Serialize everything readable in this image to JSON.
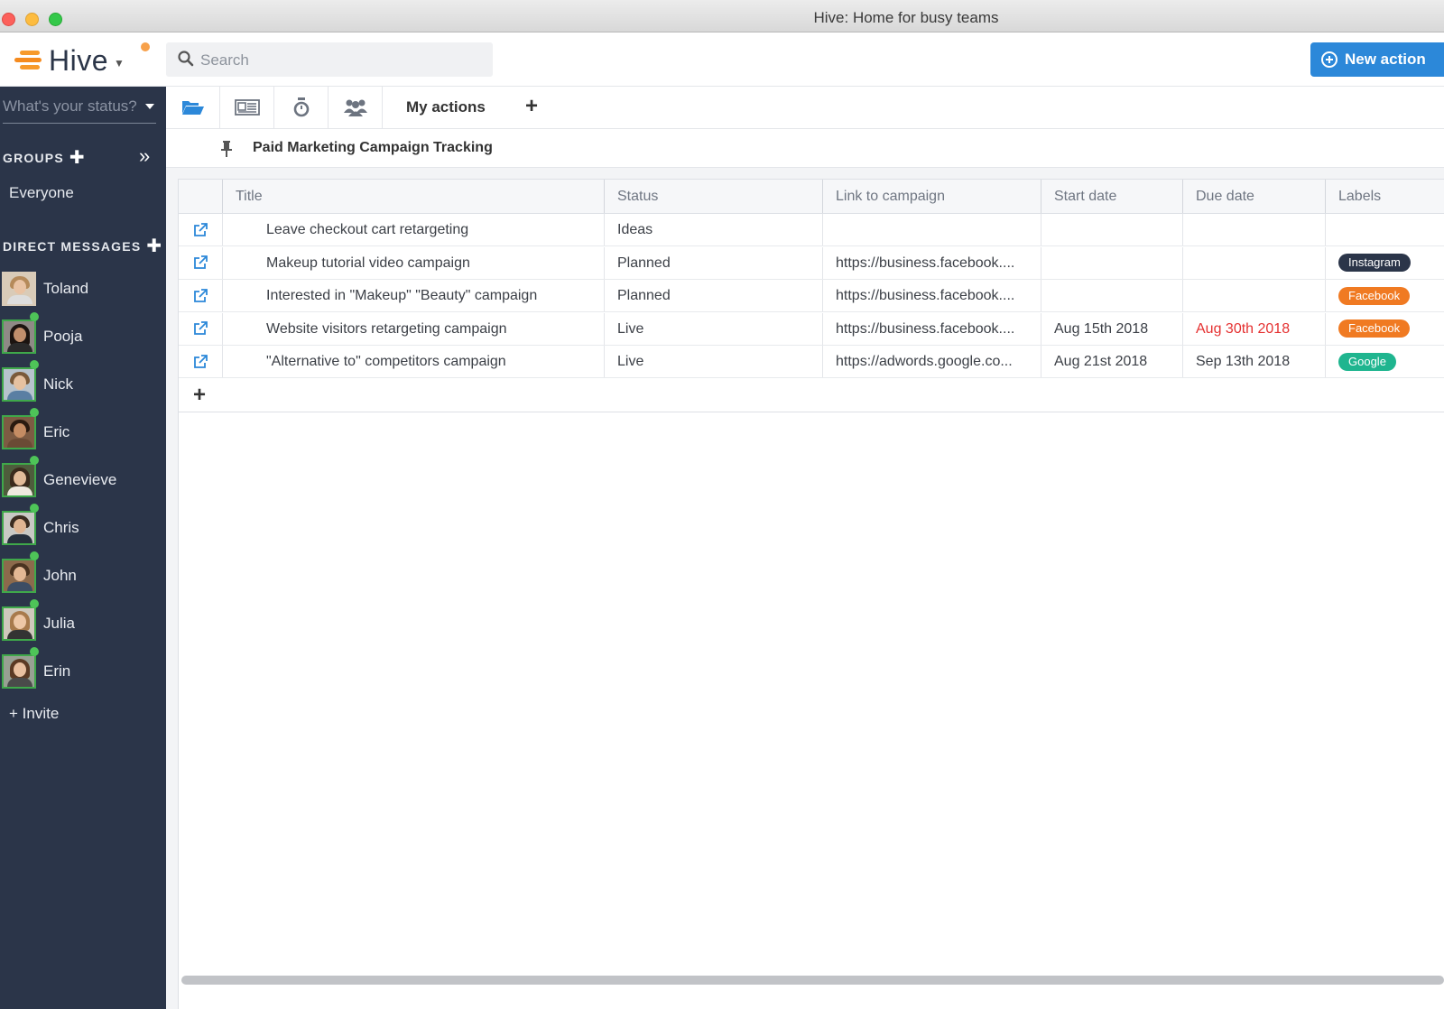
{
  "window": {
    "title": "Hive: Home for busy teams"
  },
  "header": {
    "logo_text": "Hive",
    "search_placeholder": "Search",
    "new_action_label": "New action"
  },
  "sidebar": {
    "status_placeholder": "What's your status?",
    "groups_label": "GROUPS",
    "groups": [
      "Everyone"
    ],
    "direct_messages_label": "DIRECT MESSAGES",
    "contacts": [
      {
        "name": "Toland",
        "online": false
      },
      {
        "name": "Pooja",
        "online": true
      },
      {
        "name": "Nick",
        "online": true
      },
      {
        "name": "Eric",
        "online": true
      },
      {
        "name": "Genevieve",
        "online": true
      },
      {
        "name": "Chris",
        "online": true
      },
      {
        "name": "John",
        "online": true
      },
      {
        "name": "Julia",
        "online": true
      },
      {
        "name": "Erin",
        "online": true
      }
    ],
    "invite_label": "+ Invite"
  },
  "tabs": {
    "icons": [
      "folder-icon",
      "table-view-icon",
      "timer-icon",
      "people-icon"
    ],
    "my_actions_label": "My actions",
    "add_label": "+"
  },
  "project": {
    "title": "Paid Marketing Campaign Tracking"
  },
  "table": {
    "columns": [
      "Title",
      "Status",
      "Link to campaign",
      "Start date",
      "Due date",
      "Labels"
    ],
    "rows": [
      {
        "title": "Leave checkout cart retargeting",
        "status": "Ideas",
        "link": "",
        "start": "",
        "due": "",
        "due_overdue": false,
        "label": "",
        "label_color": ""
      },
      {
        "title": "Makeup tutorial video campaign",
        "status": "Planned",
        "link": "https://business.facebook....",
        "start": "",
        "due": "",
        "due_overdue": false,
        "label": "Instagram",
        "label_color": "#2b3549"
      },
      {
        "title": "Interested in \"Makeup\" \"Beauty\" campaign",
        "status": "Planned",
        "link": "https://business.facebook....",
        "start": "",
        "due": "",
        "due_overdue": false,
        "label": "Facebook",
        "label_color": "#f07a22"
      },
      {
        "title": "Website visitors retargeting campaign",
        "status": "Live",
        "link": "https://business.facebook....",
        "start": "Aug 15th 2018",
        "due": "Aug 30th 2018",
        "due_overdue": true,
        "label": "Facebook",
        "label_color": "#f07a22"
      },
      {
        "title": "\"Alternative to\" competitors campaign",
        "status": "Live",
        "link": "https://adwords.google.co...",
        "start": "Aug 21st 2018",
        "due": "Sep 13th 2018",
        "due_overdue": false,
        "label": "Google",
        "label_color": "#1fb58f"
      }
    ],
    "add_row_label": "+"
  },
  "colors": {
    "sidebar_bg": "#2b3549",
    "accent_blue": "#2c88d9",
    "online_green": "#4ec458",
    "overdue_red": "#e53131"
  }
}
